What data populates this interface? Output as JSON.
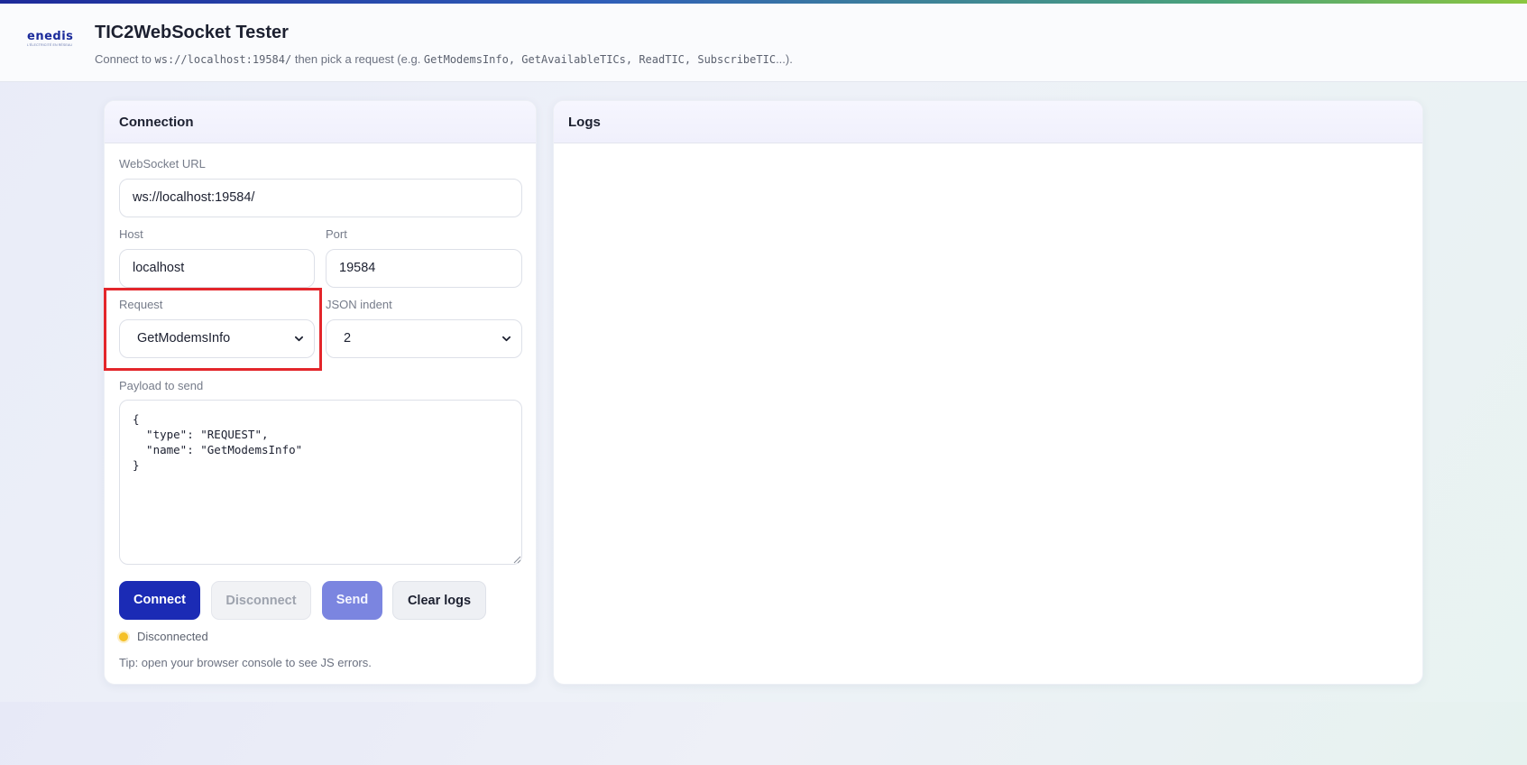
{
  "header": {
    "logo_word": "enedis",
    "logo_sub": "L'ÉLECTRICITÉ EN RÉSEAU",
    "title": "TIC2WebSocket Tester",
    "subtitle": {
      "prefix": "Connect to ",
      "url_code": "ws://localhost:19584/",
      "middle": " then pick a request (e.g. ",
      "examples_code": "GetModemsInfo, GetAvailableTICs, ReadTIC, SubscribeTIC",
      "suffix": "...)."
    }
  },
  "connection": {
    "title": "Connection",
    "ws_url_label": "WebSocket URL",
    "ws_url_value": "ws://localhost:19584/",
    "host_label": "Host",
    "host_value": "localhost",
    "port_label": "Port",
    "port_value": "19584",
    "request_label": "Request",
    "request_value": "GetModemsInfo",
    "json_indent_label": "JSON indent",
    "json_indent_value": "2",
    "payload_label": "Payload to send",
    "payload_value": "{\n  \"type\": \"REQUEST\",\n  \"name\": \"GetModemsInfo\"\n}",
    "buttons": {
      "connect": "Connect",
      "disconnect": "Disconnect",
      "send": "Send",
      "clear_logs": "Clear logs"
    },
    "status": "Disconnected",
    "status_color": "#f5c026",
    "tip": "Tip: open your browser console to see JS errors."
  },
  "logs": {
    "title": "Logs"
  },
  "colors": {
    "primary": "#1b2bb5",
    "send": "#7b85e0",
    "highlight": "#e3262b"
  }
}
